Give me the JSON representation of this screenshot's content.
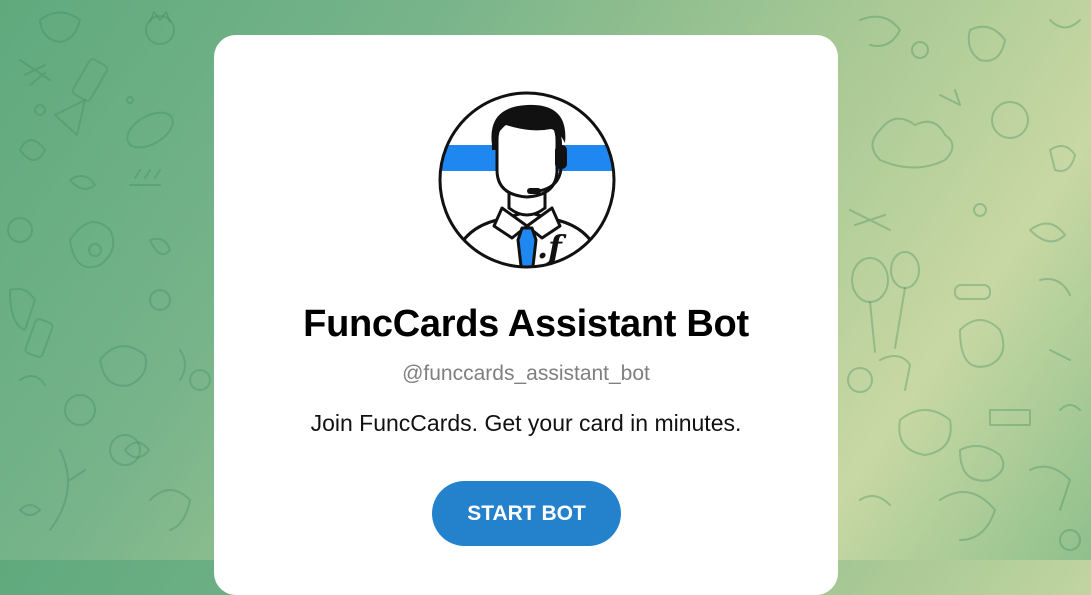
{
  "bot": {
    "name": "FuncCards Assistant Bot",
    "username": "@funccards_assistant_bot",
    "description": "Join FuncCards. Get your card in minutes.",
    "start_button_label": "START BOT"
  },
  "avatar": {
    "icon": "support-agent-icon",
    "badge_text": ".f"
  },
  "colors": {
    "accent": "#2481cc",
    "avatar_stripe": "#1e88f0",
    "background_start": "#5fa97e",
    "background_end": "#c8d8a4",
    "card": "#ffffff"
  },
  "background": {
    "pattern": "doodle-pattern"
  }
}
